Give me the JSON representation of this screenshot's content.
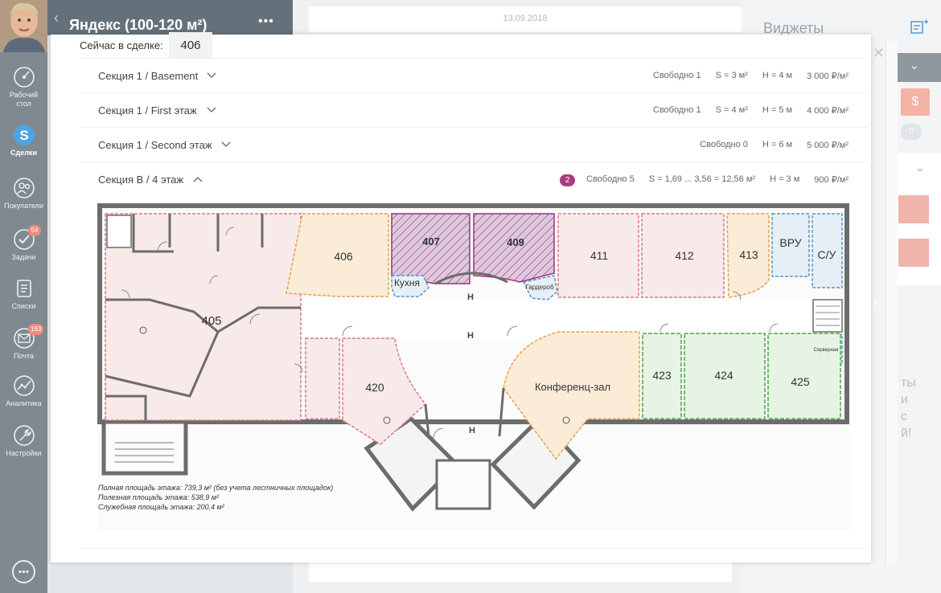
{
  "sidebar": {
    "items": [
      {
        "label": "Рабочий\nстол",
        "icon": "speedometer-icon"
      },
      {
        "label": "Сделки",
        "icon": "dollar-icon"
      },
      {
        "label": "Покупатели",
        "icon": "users-icon"
      },
      {
        "label": "Задачи",
        "icon": "check-icon",
        "badge": "54"
      },
      {
        "label": "Списки",
        "icon": "list-icon"
      },
      {
        "label": "Почта",
        "icon": "mail-icon",
        "badge": "163"
      },
      {
        "label": "Аналитика",
        "icon": "chart-icon"
      },
      {
        "label": "Настройки",
        "icon": "wrench-icon"
      }
    ]
  },
  "deal": {
    "title": "Яндекс (100-120 м²)",
    "more": "•••"
  },
  "date": "13.09.2018",
  "widgets": {
    "title": "Виджеты",
    "dollar": "$",
    "zero": "0",
    "partial_text": "ты\nи\nс\nй!"
  },
  "modal": {
    "current_label": "Сейчас в сделке:",
    "current_value": "406",
    "sections": [
      {
        "name": "Секция 1 / Basement",
        "free": "Свободно 1",
        "area": "S = 3 м²",
        "height": "H = 4 м",
        "price": "3 000 ₽/м²",
        "expanded": false
      },
      {
        "name": "Секция 1 / First этаж",
        "free": "Свободно 1",
        "area": "S = 4 м²",
        "height": "H = 5 м",
        "price": "4 000 ₽/м²",
        "expanded": false
      },
      {
        "name": "Секция 1 / Second этаж",
        "free": "Свободно 0",
        "area": "",
        "height": "H = 6 м",
        "price": "5 000 ₽/м²",
        "expanded": false
      },
      {
        "name": "Секция B / 4 этаж",
        "badge": "2",
        "free": "Свободно 5",
        "area": "S = 1,69 ... 3,56 = 12,56 м²",
        "height": "H = 3 м",
        "price": "900 ₽/м²",
        "expanded": true
      }
    ]
  },
  "floorplan": {
    "rooms": {
      "r405": "405",
      "r406": "406",
      "r407": "407",
      "r409": "409",
      "r411": "411",
      "r412": "412",
      "r413": "413",
      "vru": "ВРУ",
      "su": "С/У",
      "kitchen": "Кухня",
      "wardrobe": "Гардероб",
      "r420": "420",
      "conf": "Конференц-зал",
      "r423": "423",
      "r424": "424",
      "r425": "425",
      "server": "Серверная"
    },
    "notes": {
      "full": "Полная площадь этажа: 739,3 м² (без учета лестничных площадок)",
      "useful": "Полезная площадь этажа: 538,9 м²",
      "service": "Служебная площадь этажа: 200,4 м²"
    },
    "colors": {
      "pink_fill": "#f9eaea",
      "pink_stroke": "#d47c86",
      "orange_fill": "#fbecd8",
      "orange_stroke": "#e3a24c",
      "purple_fill": "#dcc9dd",
      "purple_stroke": "#a0317b",
      "green_fill": "#e7f4e4",
      "green_stroke": "#63b462",
      "blue_fill": "#e6eff5",
      "blue_stroke": "#5b93c9",
      "wall": "#6c6c6c"
    }
  }
}
